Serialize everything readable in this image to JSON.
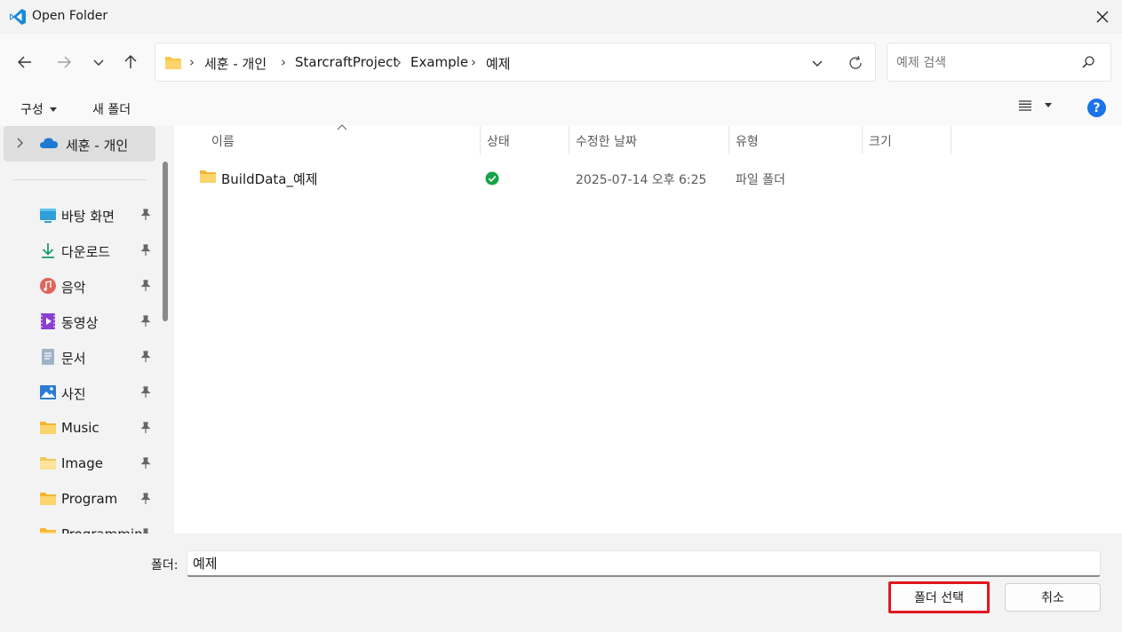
{
  "window": {
    "title": "Open Folder"
  },
  "address": {
    "crumbs": [
      "세훈 - 개인",
      "StarcraftProject",
      "Example",
      "예제"
    ]
  },
  "search": {
    "placeholder": "예제 검색"
  },
  "toolbar": {
    "organize_label": "구성",
    "new_folder_label": "새 폴더",
    "help_label": "?"
  },
  "sidebar": {
    "top_item": "세훈 - 개인",
    "items": [
      {
        "label": "바탕 화면",
        "icon": "desktop-icon"
      },
      {
        "label": "다운로드",
        "icon": "download-icon"
      },
      {
        "label": "음악",
        "icon": "music-icon"
      },
      {
        "label": "동영상",
        "icon": "video-icon"
      },
      {
        "label": "문서",
        "icon": "document-icon"
      },
      {
        "label": "사진",
        "icon": "pictures-icon"
      },
      {
        "label": "Music",
        "icon": "folder-icon"
      },
      {
        "label": "Image",
        "icon": "folder-icon"
      },
      {
        "label": "Program",
        "icon": "folder-icon"
      },
      {
        "label": "Programmin",
        "icon": "folder-icon"
      }
    ]
  },
  "columns": {
    "name": "이름",
    "status": "상태",
    "modified": "수정한 날짜",
    "type": "유형",
    "size": "크기"
  },
  "files": [
    {
      "name": "BuildData_예제",
      "modified": "2025-07-14 오후 6:25",
      "type": "파일 폴더",
      "status": "synced"
    }
  ],
  "footer": {
    "folder_label": "폴더:",
    "folder_value": "예제",
    "select_label": "폴더 선택",
    "cancel_label": "취소"
  },
  "colors": {
    "accent": "#1a73e8",
    "highlight_border": "#e0171f",
    "status_ok": "#16a34a",
    "folder": "#f7c64a"
  }
}
